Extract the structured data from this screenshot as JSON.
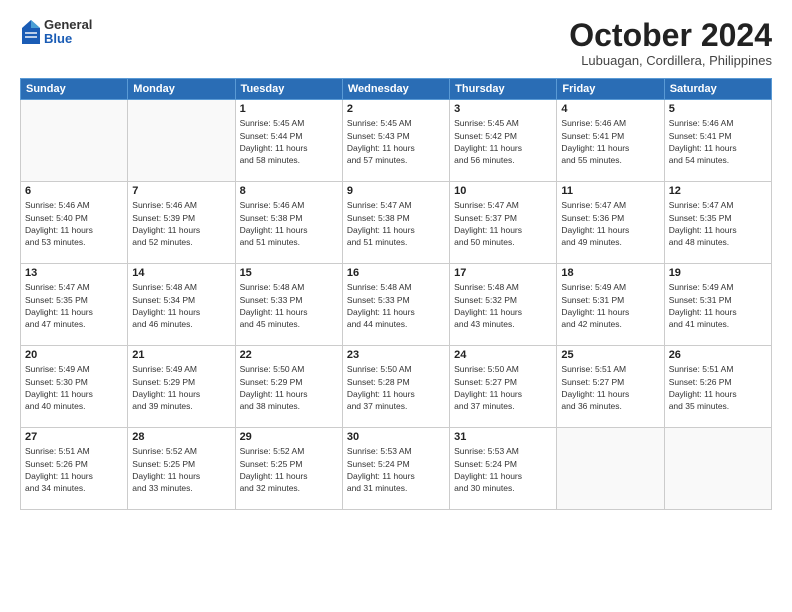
{
  "logo": {
    "general": "General",
    "blue": "Blue"
  },
  "title": "October 2024",
  "location": "Lubuagan, Cordillera, Philippines",
  "headers": [
    "Sunday",
    "Monday",
    "Tuesday",
    "Wednesday",
    "Thursday",
    "Friday",
    "Saturday"
  ],
  "weeks": [
    [
      {
        "day": "",
        "info": ""
      },
      {
        "day": "",
        "info": ""
      },
      {
        "day": "1",
        "info": "Sunrise: 5:45 AM\nSunset: 5:44 PM\nDaylight: 11 hours\nand 58 minutes."
      },
      {
        "day": "2",
        "info": "Sunrise: 5:45 AM\nSunset: 5:43 PM\nDaylight: 11 hours\nand 57 minutes."
      },
      {
        "day": "3",
        "info": "Sunrise: 5:45 AM\nSunset: 5:42 PM\nDaylight: 11 hours\nand 56 minutes."
      },
      {
        "day": "4",
        "info": "Sunrise: 5:46 AM\nSunset: 5:41 PM\nDaylight: 11 hours\nand 55 minutes."
      },
      {
        "day": "5",
        "info": "Sunrise: 5:46 AM\nSunset: 5:41 PM\nDaylight: 11 hours\nand 54 minutes."
      }
    ],
    [
      {
        "day": "6",
        "info": "Sunrise: 5:46 AM\nSunset: 5:40 PM\nDaylight: 11 hours\nand 53 minutes."
      },
      {
        "day": "7",
        "info": "Sunrise: 5:46 AM\nSunset: 5:39 PM\nDaylight: 11 hours\nand 52 minutes."
      },
      {
        "day": "8",
        "info": "Sunrise: 5:46 AM\nSunset: 5:38 PM\nDaylight: 11 hours\nand 51 minutes."
      },
      {
        "day": "9",
        "info": "Sunrise: 5:47 AM\nSunset: 5:38 PM\nDaylight: 11 hours\nand 51 minutes."
      },
      {
        "day": "10",
        "info": "Sunrise: 5:47 AM\nSunset: 5:37 PM\nDaylight: 11 hours\nand 50 minutes."
      },
      {
        "day": "11",
        "info": "Sunrise: 5:47 AM\nSunset: 5:36 PM\nDaylight: 11 hours\nand 49 minutes."
      },
      {
        "day": "12",
        "info": "Sunrise: 5:47 AM\nSunset: 5:35 PM\nDaylight: 11 hours\nand 48 minutes."
      }
    ],
    [
      {
        "day": "13",
        "info": "Sunrise: 5:47 AM\nSunset: 5:35 PM\nDaylight: 11 hours\nand 47 minutes."
      },
      {
        "day": "14",
        "info": "Sunrise: 5:48 AM\nSunset: 5:34 PM\nDaylight: 11 hours\nand 46 minutes."
      },
      {
        "day": "15",
        "info": "Sunrise: 5:48 AM\nSunset: 5:33 PM\nDaylight: 11 hours\nand 45 minutes."
      },
      {
        "day": "16",
        "info": "Sunrise: 5:48 AM\nSunset: 5:33 PM\nDaylight: 11 hours\nand 44 minutes."
      },
      {
        "day": "17",
        "info": "Sunrise: 5:48 AM\nSunset: 5:32 PM\nDaylight: 11 hours\nand 43 minutes."
      },
      {
        "day": "18",
        "info": "Sunrise: 5:49 AM\nSunset: 5:31 PM\nDaylight: 11 hours\nand 42 minutes."
      },
      {
        "day": "19",
        "info": "Sunrise: 5:49 AM\nSunset: 5:31 PM\nDaylight: 11 hours\nand 41 minutes."
      }
    ],
    [
      {
        "day": "20",
        "info": "Sunrise: 5:49 AM\nSunset: 5:30 PM\nDaylight: 11 hours\nand 40 minutes."
      },
      {
        "day": "21",
        "info": "Sunrise: 5:49 AM\nSunset: 5:29 PM\nDaylight: 11 hours\nand 39 minutes."
      },
      {
        "day": "22",
        "info": "Sunrise: 5:50 AM\nSunset: 5:29 PM\nDaylight: 11 hours\nand 38 minutes."
      },
      {
        "day": "23",
        "info": "Sunrise: 5:50 AM\nSunset: 5:28 PM\nDaylight: 11 hours\nand 37 minutes."
      },
      {
        "day": "24",
        "info": "Sunrise: 5:50 AM\nSunset: 5:27 PM\nDaylight: 11 hours\nand 37 minutes."
      },
      {
        "day": "25",
        "info": "Sunrise: 5:51 AM\nSunset: 5:27 PM\nDaylight: 11 hours\nand 36 minutes."
      },
      {
        "day": "26",
        "info": "Sunrise: 5:51 AM\nSunset: 5:26 PM\nDaylight: 11 hours\nand 35 minutes."
      }
    ],
    [
      {
        "day": "27",
        "info": "Sunrise: 5:51 AM\nSunset: 5:26 PM\nDaylight: 11 hours\nand 34 minutes."
      },
      {
        "day": "28",
        "info": "Sunrise: 5:52 AM\nSunset: 5:25 PM\nDaylight: 11 hours\nand 33 minutes."
      },
      {
        "day": "29",
        "info": "Sunrise: 5:52 AM\nSunset: 5:25 PM\nDaylight: 11 hours\nand 32 minutes."
      },
      {
        "day": "30",
        "info": "Sunrise: 5:53 AM\nSunset: 5:24 PM\nDaylight: 11 hours\nand 31 minutes."
      },
      {
        "day": "31",
        "info": "Sunrise: 5:53 AM\nSunset: 5:24 PM\nDaylight: 11 hours\nand 30 minutes."
      },
      {
        "day": "",
        "info": ""
      },
      {
        "day": "",
        "info": ""
      }
    ]
  ]
}
